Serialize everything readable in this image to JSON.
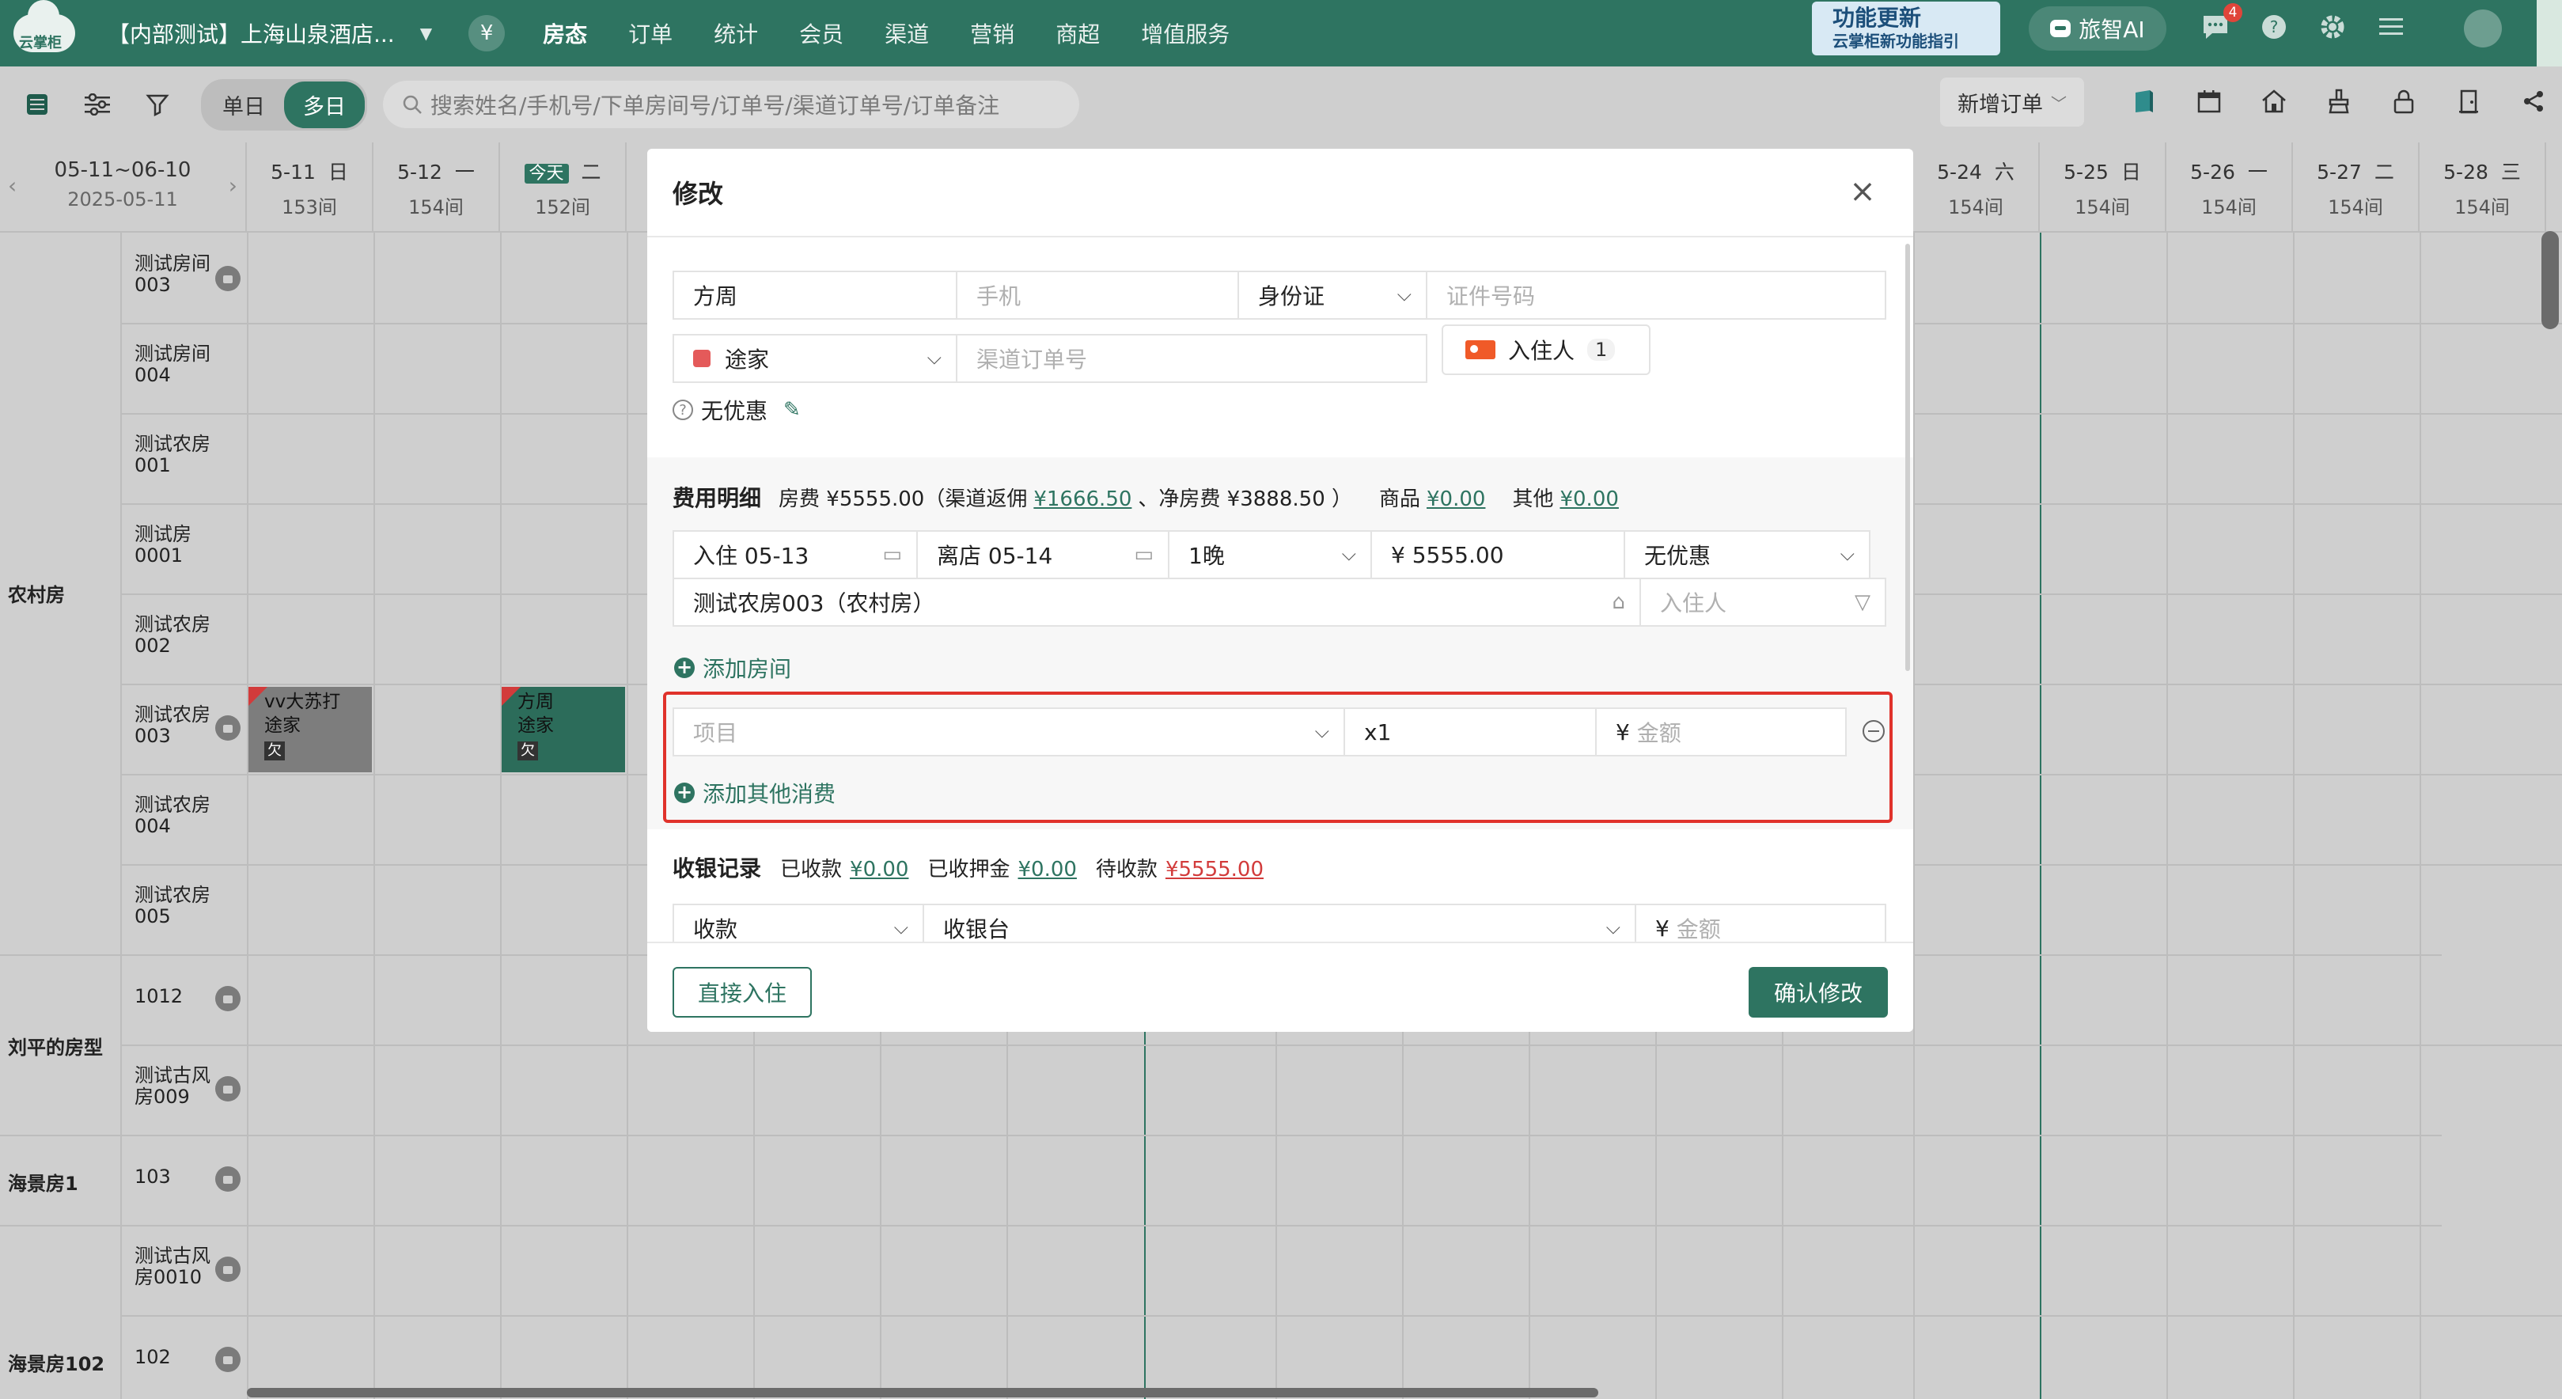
{
  "app": {
    "logo_text": "云掌柜",
    "hotel_name": "【内部测试】上海山泉酒店...",
    "yen_icon": "yen-icon",
    "nav": [
      "房态",
      "订单",
      "统计",
      "会员",
      "渠道",
      "营销",
      "商超",
      "增值服务"
    ],
    "feature_update": {
      "title": "功能更新",
      "subtitle": "云掌柜新功能指引"
    },
    "ai_label": "旅智AI",
    "message_count": "4"
  },
  "toolbar": {
    "single_day": "单日",
    "multi_day": "多日",
    "search_placeholder": "搜索姓名/手机号/下单房间号/订单号/渠道订单号/订单备注",
    "new_order": "新增订单"
  },
  "calendar": {
    "range": "05-11~06-10",
    "range_start": "2025-05-11",
    "today_tag": "今天",
    "days_left": [
      {
        "date": "5-11",
        "weekday": "日",
        "count": "153间"
      },
      {
        "date": "5-12",
        "weekday": "一",
        "count": "154间"
      },
      {
        "date": "",
        "weekday": "二",
        "count": "152间"
      }
    ],
    "days_right": [
      {
        "date": "5-24",
        "weekday": "六",
        "count": "154间"
      },
      {
        "date": "5-25",
        "weekday": "日",
        "count": "154间"
      },
      {
        "date": "5-26",
        "weekday": "一",
        "count": "154间"
      },
      {
        "date": "5-27",
        "weekday": "二",
        "count": "154间"
      },
      {
        "date": "5-28",
        "weekday": "三",
        "count": "154间"
      }
    ],
    "categories": [
      "农村房",
      "刘平的房型",
      "海景房1",
      "海景房102"
    ],
    "rooms": [
      "测试房间003",
      "测试房间004",
      "测试农房001",
      "测试房0001",
      "测试农房002",
      "测试农房003",
      "测试农房004",
      "测试农房005",
      "1012",
      "测试古风房009",
      "103",
      "测试古风房0010",
      "102"
    ],
    "bookings": [
      {
        "name": "vv大苏打",
        "channel": "途家",
        "owe": "欠"
      },
      {
        "name": "方周",
        "channel": "途家",
        "owe": "欠"
      }
    ]
  },
  "modal": {
    "title": "修改",
    "guest_name": "方周",
    "phone_placeholder": "手机",
    "id_type": "身份证",
    "id_placeholder": "证件号码",
    "channel": "途家",
    "channel_order_placeholder": "渠道订单号",
    "guest_btn": "入住人",
    "guest_count": "1",
    "discount": "无优惠",
    "fee": {
      "title": "费用明细",
      "room_fee": "房费 ¥5555.00（渠道返佣",
      "commission": "¥1666.50",
      "net_fee": "、净房费 ¥3888.50 ）",
      "goods_label": "商品",
      "goods_amount": "¥0.00",
      "other_label": "其他",
      "other_amount": "¥0.00"
    },
    "stay": {
      "checkin": "入住 05-13",
      "checkout": "离店 05-14",
      "nights": "1晚",
      "price": "¥  5555.00",
      "discount": "无优惠",
      "room": "测试农房003（农村房）",
      "guest_placeholder": "入住人"
    },
    "add_room": "添加房间",
    "extra": {
      "item_placeholder": "项目",
      "qty": "x1",
      "amount_prefix": "¥",
      "amount_placeholder": "金额"
    },
    "add_other": "添加其他消费",
    "cashier": {
      "title": "收银记录",
      "received_label": "已收款",
      "received": "¥0.00",
      "deposit_label": "已收押金",
      "deposit": "¥0.00",
      "pending_label": "待收款",
      "pending": "¥5555.00",
      "type": "收款",
      "method": "收银台",
      "amount_prefix": "¥",
      "amount_placeholder": "金额"
    },
    "btn_checkin": "直接入住",
    "btn_confirm": "确认修改"
  }
}
